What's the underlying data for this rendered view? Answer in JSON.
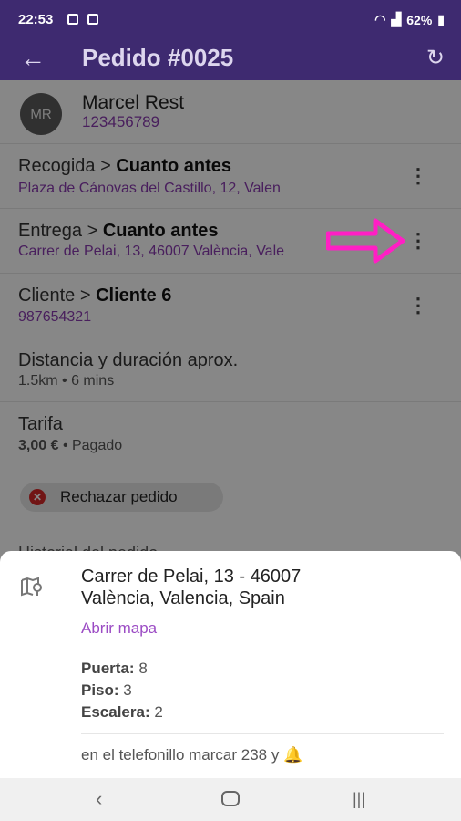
{
  "status_bar": {
    "time": "22:53",
    "battery": "62%"
  },
  "app_bar": {
    "title": "Pedido #0025"
  },
  "customer_header": {
    "initials": "MR",
    "name": "Marcel Rest",
    "phone": "123456789"
  },
  "rows": [
    {
      "label": "Recogida",
      "value": "Cuanto antes",
      "sub": "Plaza de Cánovas del Castillo, 12, Valen"
    },
    {
      "label": "Entrega",
      "value": "Cuanto antes",
      "sub": "Carrer de Pelai, 13, 46007 València, Vale"
    },
    {
      "label": "Cliente",
      "value": "Cliente 6",
      "sub": "987654321"
    }
  ],
  "distance": {
    "title": "Distancia y duración aprox.",
    "sub": "1.5km • 6 mins"
  },
  "fee": {
    "title": "Tarifa",
    "amount": "3,00 €",
    "status": "• Pagado"
  },
  "reject_button": {
    "label": "Rechazar pedido"
  },
  "history_heading": "Historial del pedido",
  "sheet": {
    "address_line1": "Carrer de Pelai, 13 - 46007",
    "address_line2": "València, Valencia, Spain",
    "open_map_label": "Abrir mapa",
    "details": [
      {
        "key": "Puerta:",
        "value": "8"
      },
      {
        "key": "Piso:",
        "value": "3"
      },
      {
        "key": "Escalera:",
        "value": "2"
      }
    ],
    "note": "en el telefonillo marcar 238 y 🔔"
  },
  "colors": {
    "primary": "#3e2a70",
    "accent": "#8a3bb0",
    "annotation": "#ff1fc4",
    "danger": "#d62828"
  },
  "icons": {
    "back": "arrow-left-icon",
    "refresh": "refresh-icon",
    "more": "more-vert-icon",
    "map": "map-pin-icon",
    "close": "close-circle-icon"
  }
}
